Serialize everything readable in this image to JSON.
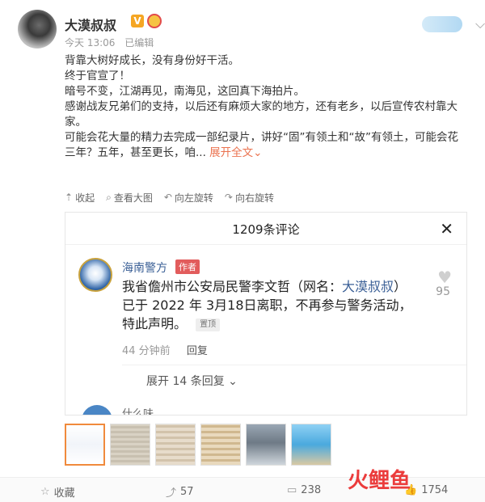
{
  "post": {
    "username": "大漠叔叔",
    "badge_v": "V",
    "time": "今天 13:06",
    "edited": "已编辑",
    "paragraphs": [
      "背靠大树好成长，没有身份好干活。",
      "终于官宣了！",
      "暗号不变，江湖再见，南海见，这回真下海拍片。",
      "感谢战友兄弟们的支持，以后还有麻烦大家的地方，还有老乡，以后宣传农村靠大家。",
      "可能会花大量的精力去完成一部纪录片，讲好“固”有领土和“故”有领土，可能会花三年？五年，甚至更长，咱..."
    ],
    "expand_label": "展开全文",
    "expand_caret": "⌄"
  },
  "image_toolbar": {
    "collapse": "收起",
    "view_large": "查看大图",
    "rotate_left": "向左旋转",
    "rotate_right": "向右旋转"
  },
  "embedded_comments": {
    "title": "1209条评论",
    "close_symbol": "✕",
    "comment": {
      "author": "海南警方",
      "author_tag": "作者",
      "text_prefix": "我省儋州市公安局民警李文哲（网名：",
      "text_link": "大漠叔叔",
      "text_suffix": "）已于 2022 年 3月18日离职，不再参与警务活动，特此声明。",
      "pin_tag": "置顶",
      "time_ago": "44 分钟前",
      "reply_label": "回复",
      "like_count": "95"
    },
    "expand_replies": "展开 14 条回复",
    "next_commenter": "什么味"
  },
  "bottom_bar": {
    "favorite": "收藏",
    "share_count": "57",
    "comment_count": "238",
    "like_count": "1754"
  },
  "watermark": "火鲤鱼"
}
